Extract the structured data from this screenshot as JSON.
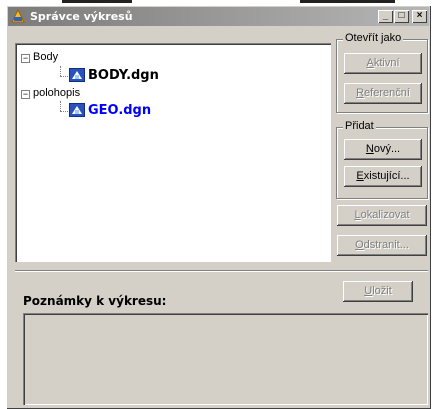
{
  "window": {
    "title": "Správce výkresů",
    "minimize_glyph": "_",
    "maximize_glyph": "□",
    "close_glyph": "×"
  },
  "tree": {
    "nodes": [
      {
        "label": "Body",
        "expander": "−",
        "files": [
          {
            "name": "BODY.dgn",
            "color": "#000000"
          }
        ]
      },
      {
        "label": "polohopis",
        "expander": "−",
        "files": [
          {
            "name": "GEO.dgn",
            "color": "#0000ff"
          }
        ]
      }
    ]
  },
  "open_as": {
    "title": "Otevřít jako",
    "active": {
      "label": "Aktivní",
      "key": "A",
      "rest": "ktivní"
    },
    "reference": {
      "label": "Referenční",
      "key": "R",
      "rest": "eferenční"
    }
  },
  "add": {
    "title": "Přidat",
    "new": {
      "label": "Nový...",
      "key": "N",
      "rest": "ový..."
    },
    "existing": {
      "label": "Existující...",
      "key": "E",
      "rest": "xistující..."
    }
  },
  "actions": {
    "locate": {
      "label": "Lokalizovat",
      "key": "L",
      "rest": "okalizovat"
    },
    "remove": {
      "label": "Odstranit...",
      "key": "O",
      "rest": "dstranit..."
    },
    "save": {
      "label": "Uložit",
      "key": "U",
      "rest": "ložit"
    }
  },
  "notes": {
    "label": "Poznámky k výkresu:",
    "value": ""
  },
  "colors": {
    "window_bg": "#d4d0c8",
    "titlebar_start": "#7b7b7b",
    "titlebar_end": "#b6b6b6",
    "file_selected": "#0000ff",
    "disabled_text": "#808080"
  }
}
